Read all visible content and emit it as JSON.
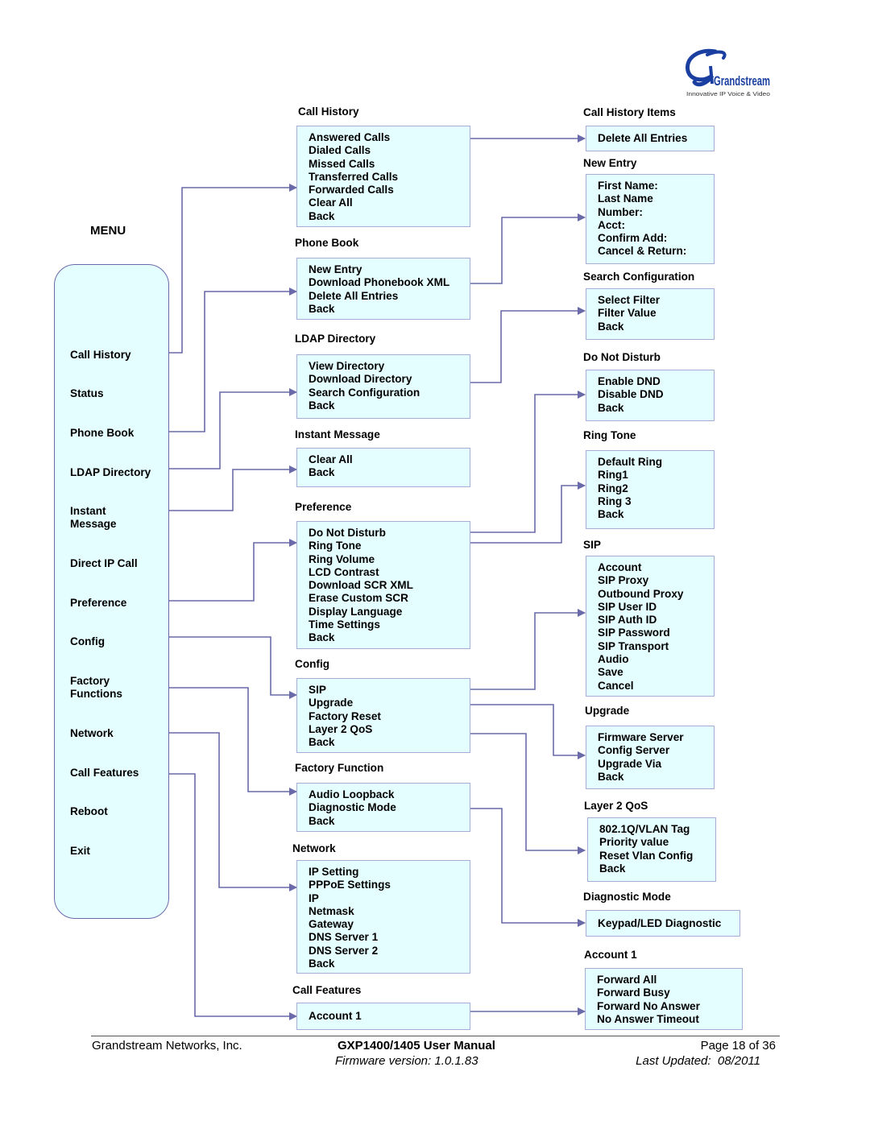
{
  "header": {
    "logo_brand": "Grandstream",
    "logo_tagline": "Innovative IP Voice & Video",
    "brand_color": "#1a3fa0"
  },
  "colors": {
    "box_fill": "#e4fdff",
    "box_border": "#a6acd6",
    "connector": "#6a6aaa"
  },
  "menu": {
    "title": "MENU",
    "items": [
      "Call History",
      "Status",
      "Phone Book",
      "LDAP Directory",
      "Instant\nMessage",
      "Direct IP Call",
      "Preference",
      "Config",
      "Factory\nFunctions",
      "Network",
      "Call Features",
      "Reboot",
      "Exit"
    ]
  },
  "middle": {
    "call_history": {
      "title": "Call History",
      "items": [
        "Answered Calls",
        "Dialed Calls",
        "Missed Calls",
        "Transferred Calls",
        "Forwarded Calls",
        "Clear All",
        "Back"
      ]
    },
    "phone_book": {
      "title": "Phone Book",
      "items": [
        "New Entry",
        "Download Phonebook XML",
        "Delete All Entries",
        "Back"
      ]
    },
    "ldap_directory": {
      "title": "LDAP Directory",
      "items": [
        "View Directory",
        "Download Directory",
        "Search Configuration",
        "Back"
      ]
    },
    "instant_message": {
      "title": "Instant Message",
      "items": [
        "Clear All",
        "Back"
      ]
    },
    "preference": {
      "title": "Preference",
      "items": [
        "Do Not Disturb",
        "Ring Tone",
        "Ring Volume",
        "LCD Contrast",
        "Download SCR XML",
        "Erase Custom SCR",
        "Display Language",
        "Time Settings",
        "Back"
      ]
    },
    "config": {
      "title": "Config",
      "items": [
        "SIP",
        "Upgrade",
        "Factory Reset",
        "Layer 2 QoS",
        "Back"
      ]
    },
    "factory_function": {
      "title": "Factory Function",
      "items": [
        "Audio Loopback",
        "Diagnostic Mode",
        "Back"
      ]
    },
    "network": {
      "title": "Network",
      "items": [
        "IP Setting",
        "PPPoE Settings",
        "IP",
        "Netmask",
        "Gateway",
        "DNS Server 1",
        "DNS Server 2",
        "Back"
      ]
    },
    "call_features": {
      "title": "Call Features",
      "items": [
        "Account 1"
      ]
    }
  },
  "right": {
    "call_history_items": {
      "title": "Call History Items",
      "items": [
        "Delete All Entries"
      ]
    },
    "new_entry": {
      "title": "New Entry",
      "items": [
        "First Name:",
        "Last Name",
        "Number:",
        "Acct:",
        "Confirm Add:",
        "Cancel & Return:"
      ]
    },
    "search_configuration": {
      "title": "Search Configuration",
      "items": [
        "Select Filter",
        "Filter Value",
        "Back"
      ]
    },
    "do_not_disturb": {
      "title": "Do Not Disturb",
      "items": [
        "Enable DND",
        "Disable DND",
        "Back"
      ]
    },
    "ring_tone": {
      "title": "Ring Tone",
      "items": [
        "Default Ring",
        "Ring1",
        "Ring2",
        "Ring 3",
        "Back"
      ]
    },
    "sip": {
      "title": "SIP",
      "items": [
        "Account",
        "SIP Proxy",
        "Outbound Proxy",
        "SIP User ID",
        "SIP Auth ID",
        "SIP Password",
        "SIP Transport",
        "Audio",
        "Save",
        "Cancel"
      ]
    },
    "upgrade": {
      "title": "Upgrade",
      "items": [
        "Firmware Server",
        "Config Server",
        "Upgrade Via",
        "Back"
      ]
    },
    "layer2_qos": {
      "title": "Layer 2 QoS",
      "items": [
        "802.1Q/VLAN Tag",
        "Priority value",
        "Reset Vlan Config",
        "Back"
      ]
    },
    "diagnostic_mode": {
      "title": "Diagnostic Mode",
      "items": [
        "Keypad/LED Diagnostic"
      ]
    },
    "account1": {
      "title": "Account 1",
      "items": [
        "Forward All",
        "Forward Busy",
        "Forward No Answer",
        "No Answer Timeout"
      ]
    }
  },
  "footer": {
    "company": "Grandstream Networks, Inc.",
    "manual_title": "GXP1400/1405 User Manual",
    "firmware": "Firmware version: 1.0.1.83",
    "page": "Page 18 of 36",
    "last_updated": "Last Updated:  08/2011"
  }
}
